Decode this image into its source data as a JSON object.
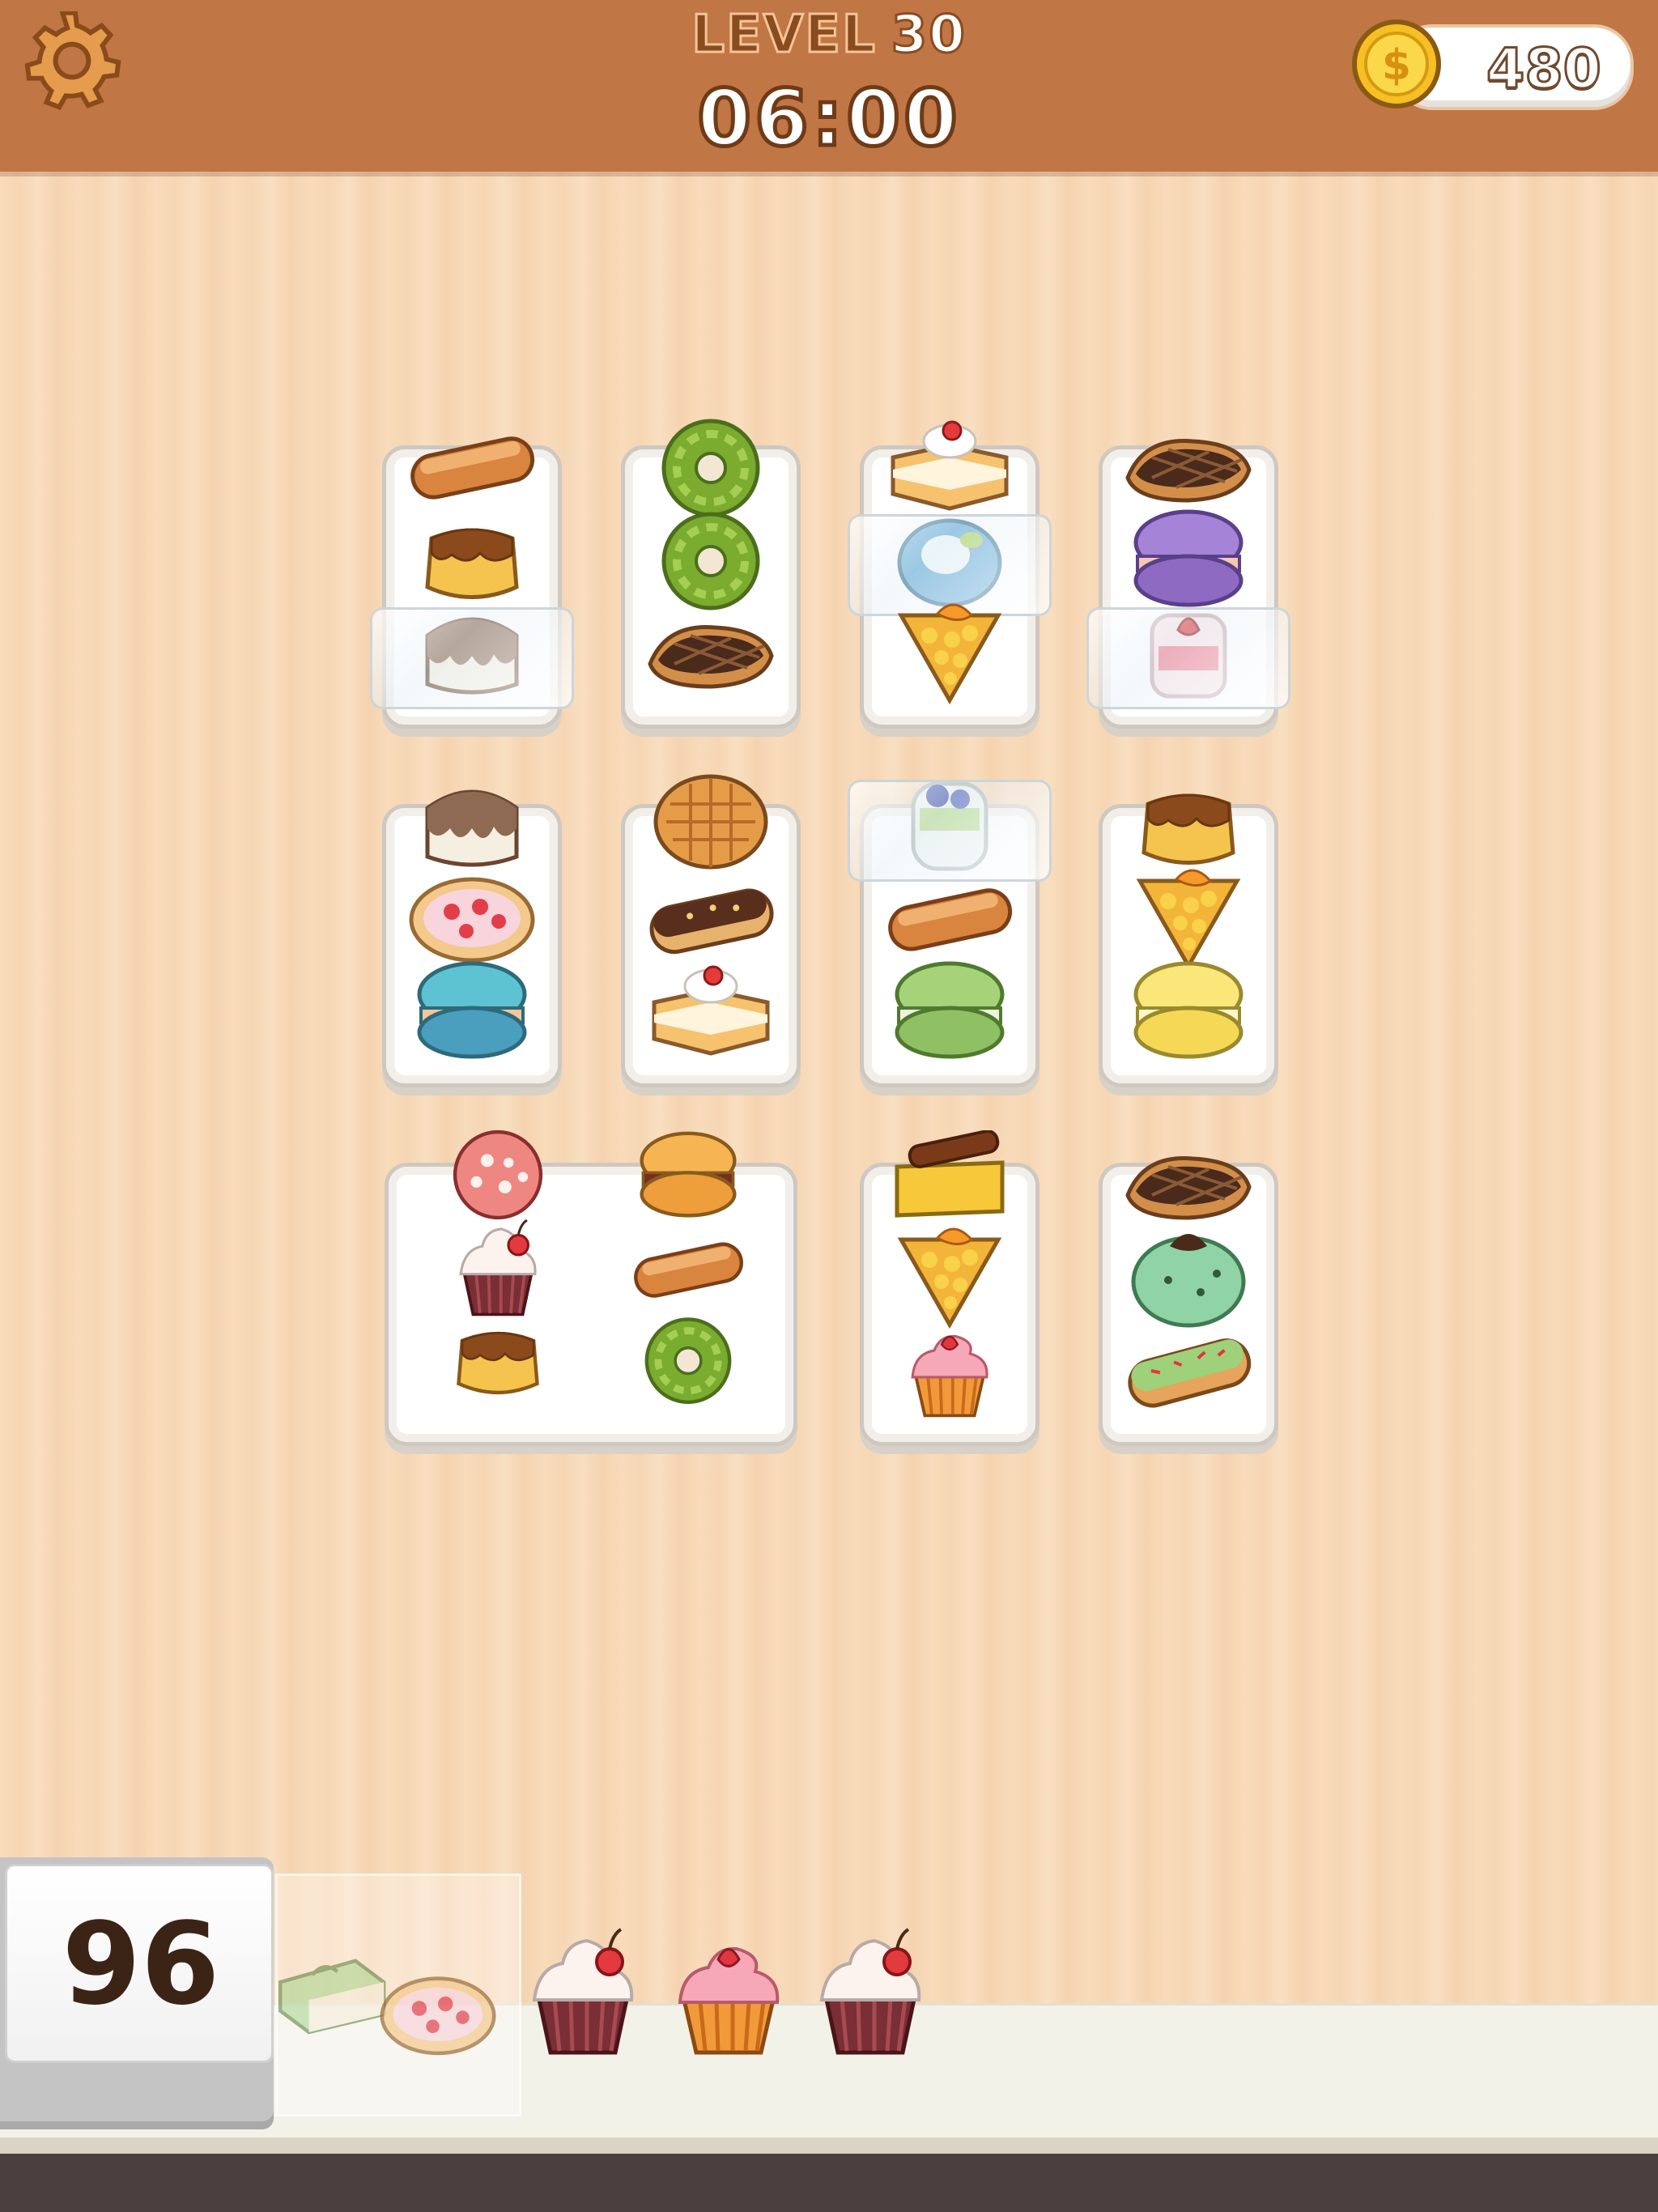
{
  "header": {
    "level_label": "LEVEL",
    "level_number": "30",
    "timer": "06:00",
    "coins": "480"
  },
  "icons": {
    "settings": "gear-icon",
    "currency": "dollar-coin-icon"
  },
  "colors": {
    "header": "#c17645",
    "background": "#f8dbbb",
    "tray": "#ffffff",
    "counter_text": "#3b2416"
  },
  "board": {
    "trays": [
      {
        "id": "tray-1",
        "items": [
          "ladyfinger",
          "caramel-pudding",
          "chocolate-drip-cake"
        ],
        "wrapped": [
          2
        ]
      },
      {
        "id": "tray-2",
        "items": [
          "matcha-donut",
          "matcha-donut",
          "chocolate-waffle"
        ],
        "wrapped": []
      },
      {
        "id": "tray-3",
        "items": [
          "cherry-cream-cake",
          "jelly-cup",
          "mango-tart"
        ],
        "wrapped": [
          1
        ]
      },
      {
        "id": "tray-4",
        "items": [
          "chocolate-waffle",
          "purple-macaron",
          "strawberry-jelly"
        ],
        "wrapped": [
          2
        ]
      },
      {
        "id": "tray-5",
        "items": [
          "chocolate-drip-cake",
          "strawberry-cookie",
          "blue-macaron"
        ],
        "wrapped": []
      },
      {
        "id": "tray-6",
        "items": [
          "round-waffle",
          "chocolate-eclair",
          "cherry-cream-cake"
        ],
        "wrapped": []
      },
      {
        "id": "tray-7",
        "items": [
          "blueberry-jelly",
          "ladyfinger",
          "green-macaron"
        ],
        "wrapped": [
          0
        ]
      },
      {
        "id": "tray-8",
        "items": [
          "caramel-pudding",
          "mango-tart",
          "yellow-macaron"
        ],
        "wrapped": []
      },
      {
        "id": "tray-9",
        "items": [
          "strawberry-roll",
          "cherry-cupcake",
          "caramel-pudding",
          "orange-macaron",
          "ladyfinger",
          "matcha-donut"
        ],
        "wrapped": []
      },
      {
        "id": "tray-10",
        "items": [
          "cinnamon-custard",
          "mango-tart",
          "strawberry-cupcake"
        ],
        "wrapped": []
      },
      {
        "id": "tray-11",
        "items": [
          "chocolate-waffle",
          "mint-mousse",
          "pistachio-eclair"
        ],
        "wrapped": []
      }
    ]
  },
  "dock": {
    "remaining_count": "96",
    "queued_items": [
      "matcha-cake",
      "strawberry-cookie"
    ],
    "slots": [
      "cherry-cupcake",
      "strawberry-cupcake",
      "cherry-cupcake"
    ]
  }
}
